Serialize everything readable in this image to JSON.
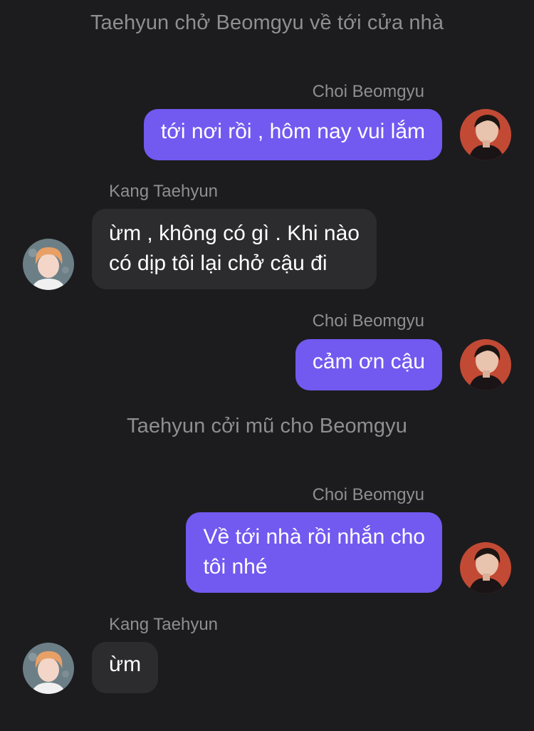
{
  "chat": {
    "narration_1": "Taehyun chở Beomgyu về tới cửa nhà",
    "narration_2": "Taehyun cởi mũ cho Beomgyu",
    "messages": [
      {
        "sender": "Choi Beomgyu",
        "lines": [
          "tới nơi rồi , hôm nay vui lắm"
        ]
      },
      {
        "sender": "Kang Taehyun",
        "lines": [
          "ừm , không có gì . Khi nào",
          "có dịp tôi lại chở cậu đi"
        ]
      },
      {
        "sender": "Choi Beomgyu",
        "lines": [
          "cảm ơn cậu"
        ]
      },
      {
        "sender": "Choi Beomgyu",
        "lines": [
          "Về tới nhà rồi nhắn cho",
          "tôi nhé"
        ]
      },
      {
        "sender": "Kang Taehyun",
        "lines": [
          "ừm"
        ]
      }
    ]
  },
  "colors": {
    "background": "#1c1c1e",
    "outgoing_bubble": "#7259f0",
    "incoming_bubble": "#2c2c2e",
    "secondary_text": "#8e8e93"
  },
  "icons": {
    "beomgyu_avatar": "avatar-beomgyu-icon",
    "taehyun_avatar": "avatar-taehyun-icon"
  }
}
